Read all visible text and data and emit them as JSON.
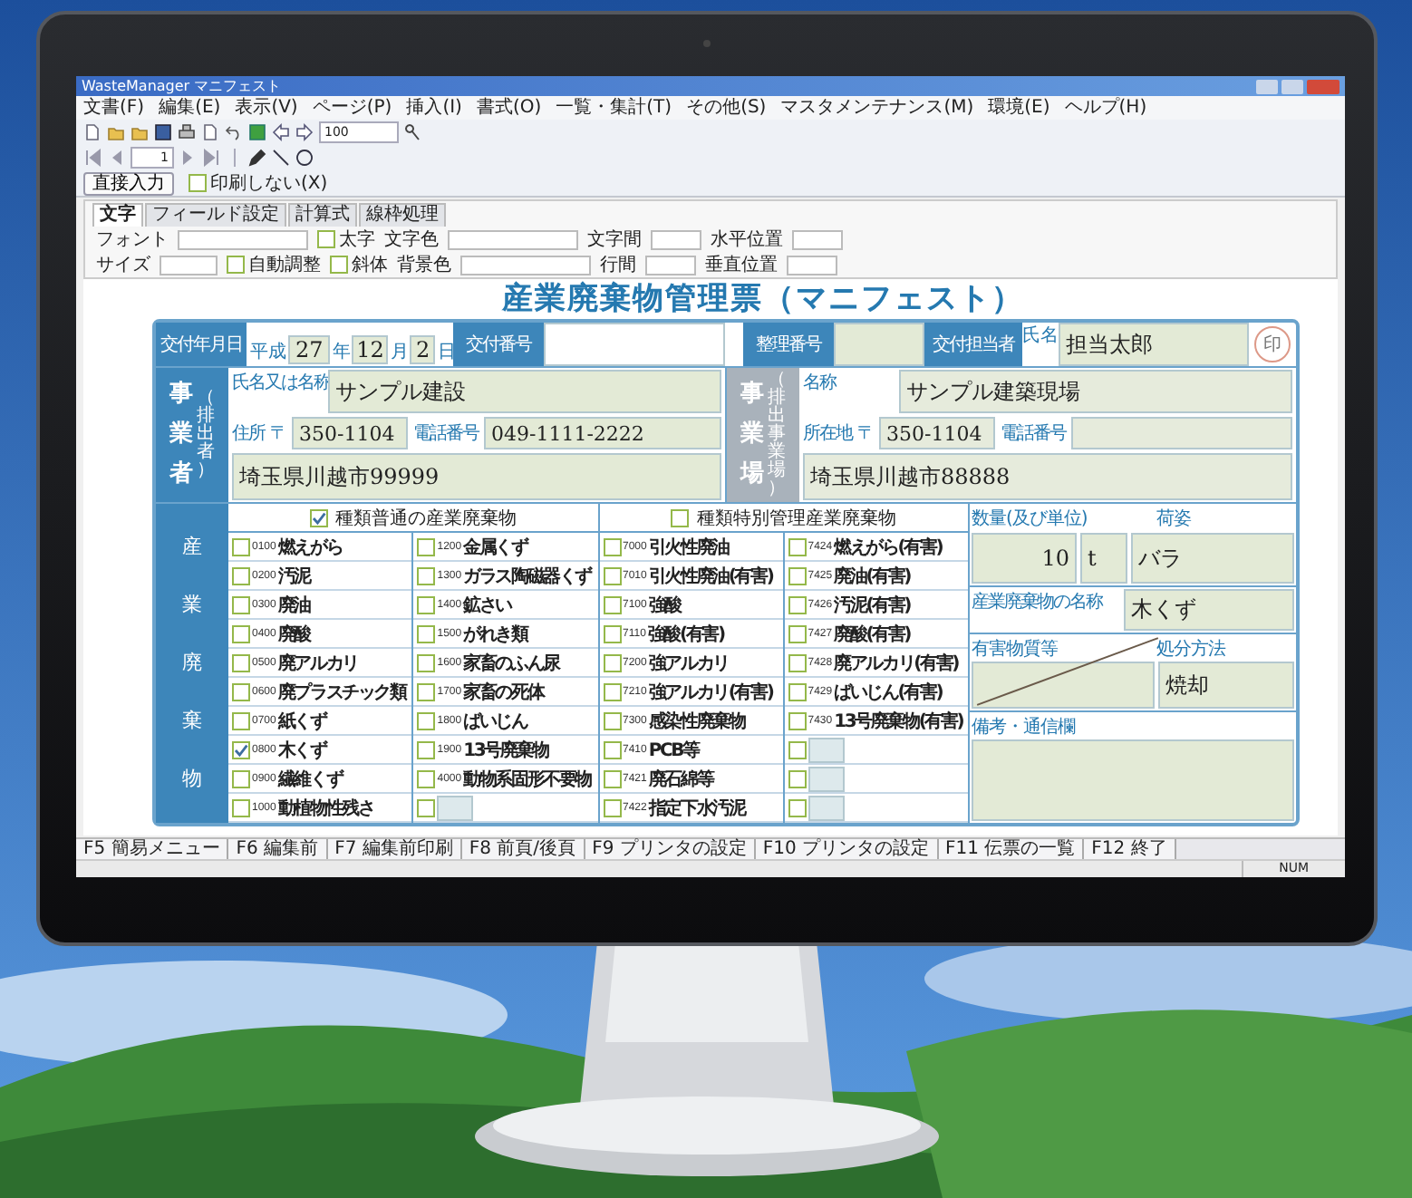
{
  "window": {
    "title": "WasteManager マニフェスト"
  },
  "menu": [
    "文書(F)",
    "編集(E)",
    "表示(V)",
    "ページ(P)",
    "挿入(I)",
    "書式(O)",
    "一覧・集計(T)",
    "その他(S)",
    "マスタメンテナンス(M)",
    "環境(E)",
    "ヘルプ(H)"
  ],
  "toolbar": {
    "page": "1",
    "zoom": "100"
  },
  "action_row": {
    "button": "直接入力",
    "options": [
      {
        "label": "印刷しない(X)",
        "checked": false
      }
    ]
  },
  "format_panel": {
    "tabs": [
      {
        "label": "文字",
        "selected": true
      },
      {
        "label": "フィールド設定",
        "selected": false
      },
      {
        "label": "計算式",
        "selected": false
      },
      {
        "label": "線枠処理",
        "selected": false
      }
    ],
    "top_controls": [
      {
        "kind": "select",
        "label": "フォント"
      },
      {
        "kind": "check",
        "label": "太字",
        "checked": false
      },
      {
        "kind": "select",
        "label": "文字色"
      },
      {
        "kind": "spin",
        "label": "文字間"
      },
      {
        "kind": "spin",
        "label": "水平位置"
      }
    ],
    "bottom_controls": [
      {
        "kind": "small",
        "label": "サイズ"
      },
      {
        "kind": "check",
        "label": "自動調整",
        "checked": false
      },
      {
        "kind": "check",
        "label": "斜体",
        "checked": false
      },
      {
        "kind": "select",
        "label": "背景色"
      },
      {
        "kind": "spin",
        "label": "行間"
      },
      {
        "kind": "spin",
        "label": "垂直位置"
      }
    ]
  },
  "form": {
    "title": "産業廃棄物管理票（マニフェスト）",
    "issue_date": {
      "label": "交付年月日",
      "era": "平成",
      "year": "27",
      "year_unit": "年",
      "month": "12",
      "month_unit": "月",
      "day": "2",
      "day_unit": "日"
    },
    "issue_no": {
      "label": "交付番号"
    },
    "ref_no": {
      "label": "整理番号"
    },
    "person": {
      "label": "交付担当者",
      "name_label": "氏名",
      "value": "担当太郎",
      "seal": "印"
    },
    "generator": {
      "heading": "事業者",
      "sub": "（排出者）",
      "name_label": "氏名又は名称",
      "name": "サンプル建設",
      "address_label": "住所",
      "postal_mark": "〒",
      "postal": "350-1104",
      "phone_label": "電話番号",
      "phone": "049-1111-2222",
      "address": "埼玉県川越市99999",
      "disabled": false
    },
    "site": {
      "heading": "事業場",
      "sub": "（排出事業場）",
      "name_label": "名称",
      "name": "サンプル建築現場",
      "address_label": "所在地",
      "postal_mark": "〒",
      "postal": "350-1104",
      "phone_label": "電話番号",
      "address": "埼玉県川越市88888",
      "disabled": true
    },
    "waste": {
      "heading": "産業廃棄物",
      "groups": [
        {
          "label": "種類普通の産業廃棄物",
          "checked": true
        },
        {
          "label": "種類特別管理産業廃棄物",
          "checked": false
        }
      ],
      "columns": [
        [
          {
            "kind": "item",
            "code": "0100",
            "name": "燃えがら",
            "checked": false
          },
          {
            "kind": "item",
            "code": "0200",
            "name": "汚泥",
            "checked": false
          },
          {
            "kind": "item",
            "code": "0300",
            "name": "廃油",
            "checked": false
          },
          {
            "kind": "item",
            "code": "0400",
            "name": "廃酸",
            "checked": false
          },
          {
            "kind": "item",
            "code": "0500",
            "name": "廃アルカリ",
            "checked": false
          },
          {
            "kind": "item",
            "code": "0600",
            "name": "廃プラスチック類",
            "checked": false
          },
          {
            "kind": "item",
            "code": "0700",
            "name": "紙くず",
            "checked": false
          },
          {
            "kind": "item",
            "code": "0800",
            "name": "木くず",
            "checked": true
          },
          {
            "kind": "item",
            "code": "0900",
            "name": "繊維くず",
            "checked": false
          },
          {
            "kind": "item",
            "code": "1000",
            "name": "動植物性残さ",
            "checked": false
          }
        ],
        [
          {
            "kind": "item",
            "code": "1200",
            "name": "金属くず",
            "checked": false
          },
          {
            "kind": "item",
            "code": "1300",
            "name": "ガラス陶磁器くず",
            "checked": false
          },
          {
            "kind": "item",
            "code": "1400",
            "name": "鉱さい",
            "checked": false
          },
          {
            "kind": "item",
            "code": "1500",
            "name": "がれき類",
            "checked": false
          },
          {
            "kind": "item",
            "code": "1600",
            "name": "家畜のふん尿",
            "checked": false
          },
          {
            "kind": "item",
            "code": "1700",
            "name": "家畜の死体",
            "checked": false
          },
          {
            "kind": "item",
            "code": "1800",
            "name": "ばいじん",
            "checked": false
          },
          {
            "kind": "item",
            "code": "1900",
            "name": "13号廃棄物",
            "checked": false
          },
          {
            "kind": "item",
            "code": "4000",
            "name": "動物系固形不要物",
            "checked": false
          },
          {
            "kind": "blank",
            "checked": false
          }
        ],
        [
          {
            "kind": "item",
            "code": "7000",
            "name": "引火性廃油",
            "checked": false
          },
          {
            "kind": "item",
            "code": "7010",
            "name": "引火性廃油(有害)",
            "checked": false
          },
          {
            "kind": "item",
            "code": "7100",
            "name": "強酸",
            "checked": false
          },
          {
            "kind": "item",
            "code": "7110",
            "name": "強酸(有害)",
            "checked": false
          },
          {
            "kind": "item",
            "code": "7200",
            "name": "強アルカリ",
            "checked": false
          },
          {
            "kind": "item",
            "code": "7210",
            "name": "強アルカリ(有害)",
            "checked": false
          },
          {
            "kind": "item",
            "code": "7300",
            "name": "感染性廃棄物",
            "checked": false
          },
          {
            "kind": "item",
            "code": "7410",
            "name": "PCB等",
            "checked": false
          },
          {
            "kind": "item",
            "code": "7421",
            "name": "廃石綿等",
            "checked": false
          },
          {
            "kind": "item",
            "code": "7422",
            "name": "指定下水汚泥",
            "checked": false
          }
        ],
        [
          {
            "kind": "item",
            "code": "7424",
            "name": "燃えがら(有害)",
            "checked": false
          },
          {
            "kind": "item",
            "code": "7425",
            "name": "廃油(有害)",
            "checked": false
          },
          {
            "kind": "item",
            "code": "7426",
            "name": "汚泥(有害)",
            "checked": false
          },
          {
            "kind": "item",
            "code": "7427",
            "name": "廃酸(有害)",
            "checked": false
          },
          {
            "kind": "item",
            "code": "7428",
            "name": "廃アルカリ(有害)",
            "checked": false
          },
          {
            "kind": "item",
            "code": "7429",
            "name": "ばいじん(有害)",
            "checked": false
          },
          {
            "kind": "item",
            "code": "7430",
            "name": "13号廃棄物(有害)",
            "checked": false
          },
          {
            "kind": "blank",
            "checked": false
          },
          {
            "kind": "blank",
            "checked": false
          },
          {
            "kind": "blank",
            "checked": false
          }
        ]
      ]
    },
    "details": {
      "qty_label": "数量(及び単位)",
      "qty": "10",
      "unit": "t",
      "pack_label": "荷姿",
      "pack": "バラ",
      "name_label": "産業廃棄物の名称",
      "name": "木くず",
      "hazard_label": "有害物質等",
      "method_label": "処分方法",
      "method": "焼却",
      "notes_label": "備考・通信欄"
    }
  },
  "function_keys": [
    {
      "key": "F5",
      "label": "簡易メニュー"
    },
    {
      "key": "F6",
      "label": "編集前"
    },
    {
      "key": "F7",
      "label": "編集前印刷"
    },
    {
      "key": "F8",
      "label": "前頁/後頁"
    },
    {
      "key": "F9",
      "label": "プリンタの設定"
    },
    {
      "key": "F10",
      "label": "プリンタの設定"
    },
    {
      "key": "F11",
      "label": "伝票の一覧"
    },
    {
      "key": "F12",
      "label": "終了"
    }
  ],
  "status_bar": {
    "indicator": "NUM"
  }
}
